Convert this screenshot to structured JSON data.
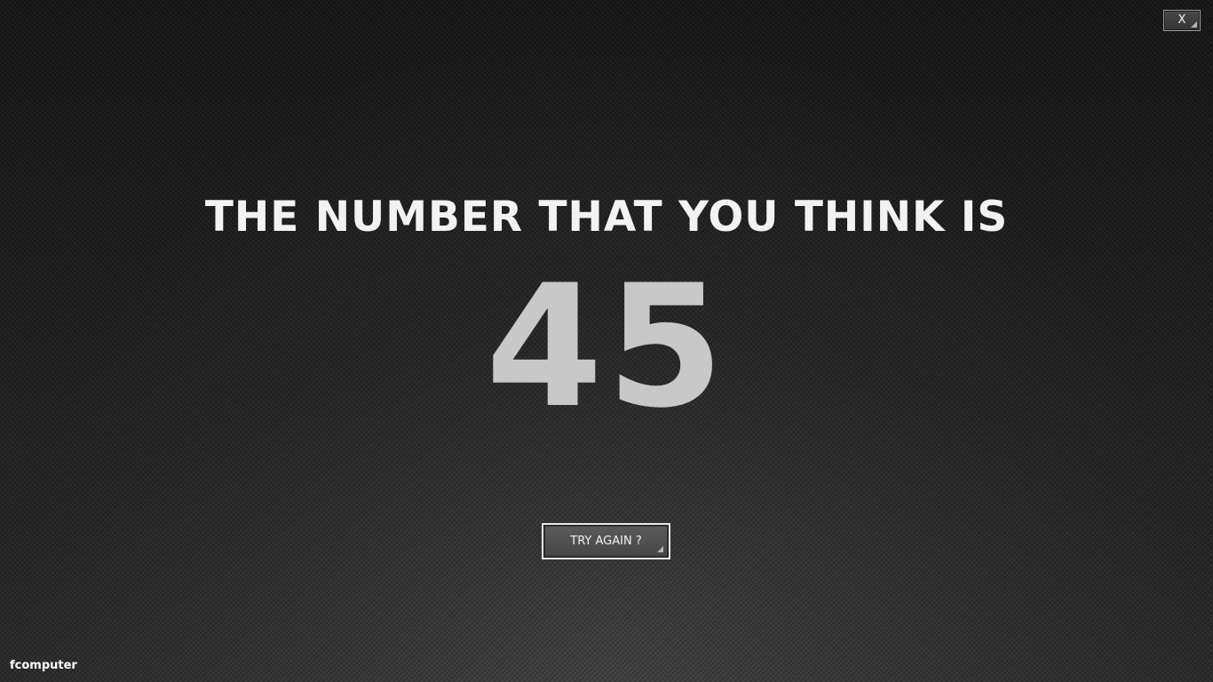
{
  "window": {
    "close_label": "X"
  },
  "main": {
    "headline": "THE NUMBER THAT YOU THINK IS",
    "result_number": "45",
    "try_again_label": "TRY AGAIN ?"
  },
  "footer": {
    "brand": "fcomputer"
  },
  "colors": {
    "background": "#1e1e1e",
    "headline_text": "#f2f2f2",
    "number_text": "#c8c8c8",
    "button_face": "#4f4f4f",
    "button_border": "#e6e6e6"
  },
  "icons": {
    "button_corner": "resize-grip-icon"
  }
}
